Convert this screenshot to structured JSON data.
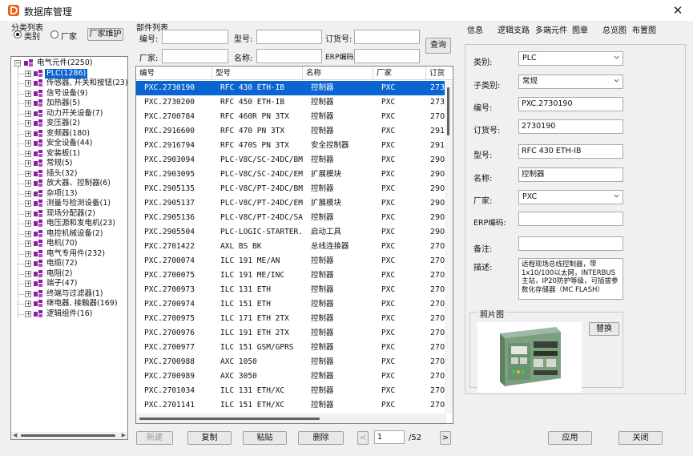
{
  "window": {
    "title": "数据库管理",
    "close_symbol": "✕"
  },
  "left": {
    "section_label": "分类列表",
    "radio_category": "类别",
    "radio_vendor": "厂家",
    "vendor_button": "厂家维护",
    "tree": {
      "root": "电气元件(2250)",
      "items": [
        {
          "label": "PLC(1286)",
          "selected": true
        },
        {
          "label": "传感器, 开关和按钮(23)"
        },
        {
          "label": "信号设备(9)"
        },
        {
          "label": "加热器(5)"
        },
        {
          "label": "动力开关设备(7)"
        },
        {
          "label": "变压器(2)"
        },
        {
          "label": "变频器(180)"
        },
        {
          "label": "安全设备(44)"
        },
        {
          "label": "安装板(1)"
        },
        {
          "label": "常规(5)"
        },
        {
          "label": "插头(32)"
        },
        {
          "label": "放大器、控制器(6)"
        },
        {
          "label": "杂项(13)"
        },
        {
          "label": "测量与检测设备(1)"
        },
        {
          "label": "现场分配器(2)"
        },
        {
          "label": "电压源和发电机(23)"
        },
        {
          "label": "电控机械设备(2)"
        },
        {
          "label": "电机(70)"
        },
        {
          "label": "电气专用件(232)"
        },
        {
          "label": "电缆(72)"
        },
        {
          "label": "电阻(2)"
        },
        {
          "label": "端子(47)"
        },
        {
          "label": "终端与过滤器(1)"
        },
        {
          "label": "继电器, 接触器(169)"
        },
        {
          "label": "逻辑组件(16)"
        }
      ]
    }
  },
  "search": {
    "section_label": "部件列表",
    "code_label": "编号:",
    "code_value": "",
    "model_label": "型号:",
    "model_value": "",
    "order_label": "订货号:",
    "order_value": "",
    "vendor_label": "厂家:",
    "vendor_value": "",
    "name_label": "名称:",
    "name_value": "",
    "erp_label": "ERP编码:",
    "erp_value": "",
    "query_button": "查询"
  },
  "table": {
    "columns": [
      "编号",
      "型号",
      "名称",
      "厂家",
      "订货"
    ],
    "rows": [
      [
        "PXC.2730190",
        "RFC 430 ETH-IB",
        "控制器",
        "PXC",
        "273"
      ],
      [
        "PXC.2730200",
        "RFC 450 ETH-IB",
        "控制器",
        "PXC",
        "273"
      ],
      [
        "PXC.2700784",
        "RFC 460R PN 3TX",
        "控制器",
        "PXC",
        "270"
      ],
      [
        "PXC.2916600",
        "RFC 470 PN 3TX",
        "控制器",
        "PXC",
        "291"
      ],
      [
        "PXC.2916794",
        "RFC 470S PN 3TX",
        "安全控制器",
        "PXC",
        "291"
      ],
      [
        "PXC.2903094",
        "PLC-V8C/SC-24DC/BM",
        "控制器",
        "PXC",
        "290"
      ],
      [
        "PXC.2903095",
        "PLC-V8C/SC-24DC/EM",
        "扩展模块",
        "PXC",
        "290"
      ],
      [
        "PXC.2905135",
        "PLC-V8C/PT-24DC/BM",
        "控制器",
        "PXC",
        "290"
      ],
      [
        "PXC.2905137",
        "PLC-V8C/PT-24DC/EM",
        "扩展模块",
        "PXC",
        "290"
      ],
      [
        "PXC.2905136",
        "PLC-V8C/PT-24DC/SAM",
        "控制器",
        "PXC",
        "290"
      ],
      [
        "PXC.2905504",
        "PLC-LOGIC-STARTER...",
        "启动工具",
        "PXC",
        "290"
      ],
      [
        "PXC.2701422",
        "AXL BS BK",
        "总线连接器",
        "PXC",
        "270"
      ],
      [
        "PXC.2700074",
        "ILC 191 ME/AN",
        "控制器",
        "PXC",
        "270"
      ],
      [
        "PXC.2700075",
        "ILC 191 ME/INC",
        "控制器",
        "PXC",
        "270"
      ],
      [
        "PXC.2700973",
        "ILC 131 ETH",
        "控制器",
        "PXC",
        "270"
      ],
      [
        "PXC.2700974",
        "ILC 151 ETH",
        "控制器",
        "PXC",
        "270"
      ],
      [
        "PXC.2700975",
        "ILC 171 ETH 2TX",
        "控制器",
        "PXC",
        "270"
      ],
      [
        "PXC.2700976",
        "ILC 191 ETH 2TX",
        "控制器",
        "PXC",
        "270"
      ],
      [
        "PXC.2700977",
        "ILC 151 GSM/GPRS",
        "控制器",
        "PXC",
        "270"
      ],
      [
        "PXC.2700988",
        "AXC 1050",
        "控制器",
        "PXC",
        "270"
      ],
      [
        "PXC.2700989",
        "AXC 3050",
        "控制器",
        "PXC",
        "270"
      ],
      [
        "PXC.2701034",
        "ILC 131 ETH/XC",
        "控制器",
        "PXC",
        "270"
      ],
      [
        "PXC.2701141",
        "ILC 151 ETH/XC",
        "控制器",
        "PXC",
        "270"
      ]
    ]
  },
  "bottom": {
    "new_button": "新建",
    "copy_button": "复制",
    "paste_button": "粘贴",
    "delete_button": "删除",
    "prev_symbol": "<",
    "next_symbol": ">",
    "page_value": "1",
    "page_total": "/52",
    "apply_button": "应用",
    "close_button": "关闭"
  },
  "tabs": [
    "信息",
    "逻辑支路",
    "多端元件",
    "图章",
    "总览图",
    "布置图"
  ],
  "detail": {
    "category_label": "类别:",
    "category_value": "PLC",
    "subcategory_label": "子类别:",
    "subcategory_value": "常规",
    "code_label": "编号:",
    "code_value": "PXC.2730190",
    "order_label": "订货号:",
    "order_value": "2730190",
    "model_label": "型号:",
    "model_value": "RFC 430 ETH-IB",
    "name_label": "名称:",
    "name_value": "控制器",
    "vendor_label": "厂家:",
    "vendor_value": "PXC",
    "erp_label": "ERP编码:",
    "erp_value": "",
    "note_label": "备注:",
    "note_value": "",
    "desc_label": "描述:",
    "desc_value": "远程现场总线控制器，带1x10/100以太网，INTERBUS主站，IP20防护等级，可插拔参数化存储器（MC FLASH）",
    "photo_label": "照片图",
    "replace_button": "替换"
  },
  "colors": {
    "selection": "#0a64d2",
    "logo": "#e8641e",
    "tree_icon": "#8c1ea0"
  }
}
